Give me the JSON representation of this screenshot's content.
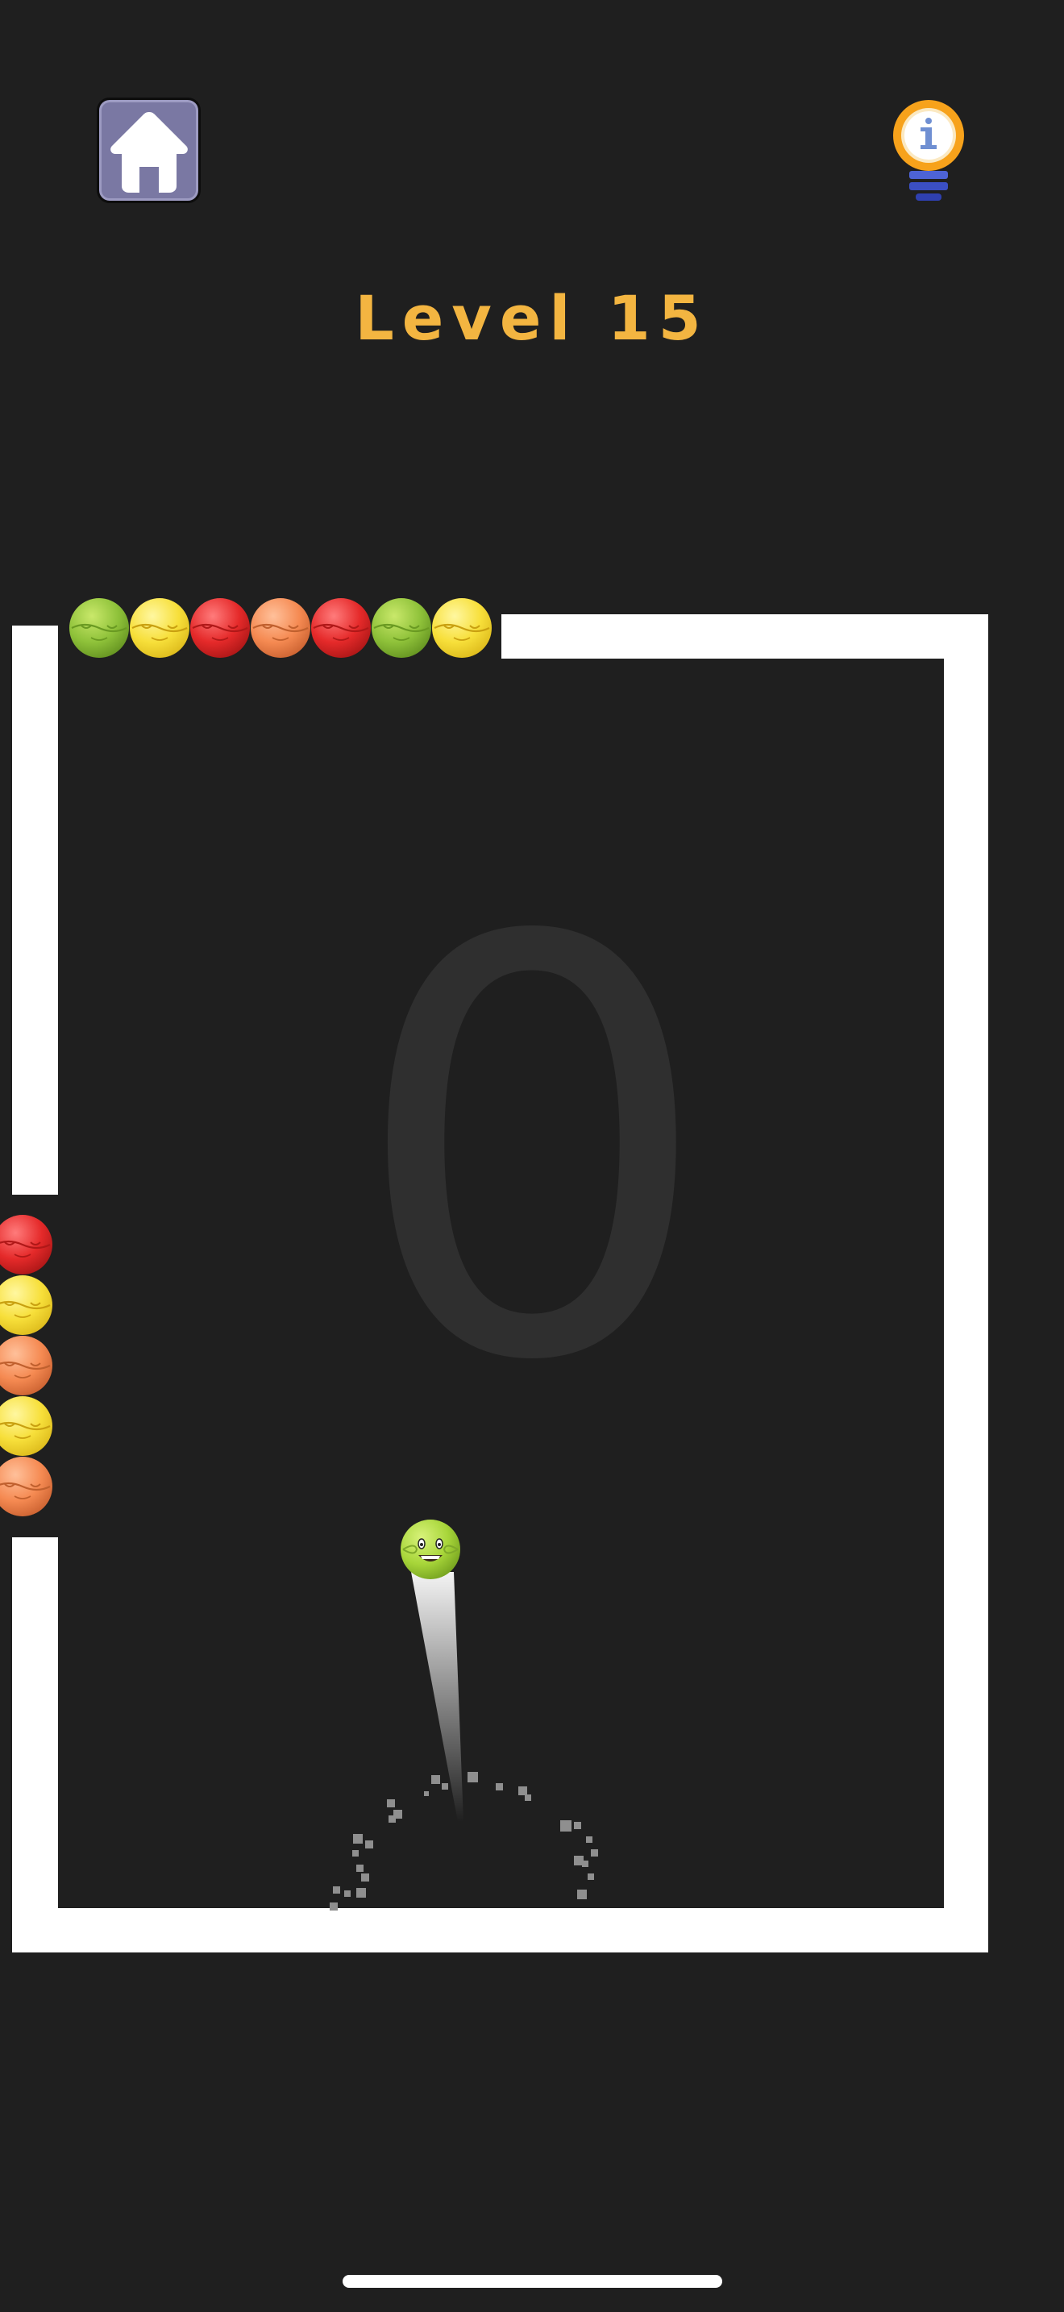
{
  "header": {
    "home_icon": "house-icon",
    "hint_icon": "lightbulb-info-icon",
    "level_label": "Level 15"
  },
  "score": "0",
  "colors": {
    "background": "#1f1f1f",
    "wall": "#ffffff",
    "title": "#f3b541",
    "score_text": "#2f2f2f",
    "home_button": "#7a78a3"
  },
  "queues": {
    "top": [
      "green",
      "yellow",
      "red",
      "orange",
      "red",
      "green",
      "yellow"
    ],
    "left": [
      "red",
      "yellow",
      "orange",
      "yellow",
      "orange"
    ]
  },
  "player_ball": {
    "color": "green",
    "face": "smiling"
  }
}
